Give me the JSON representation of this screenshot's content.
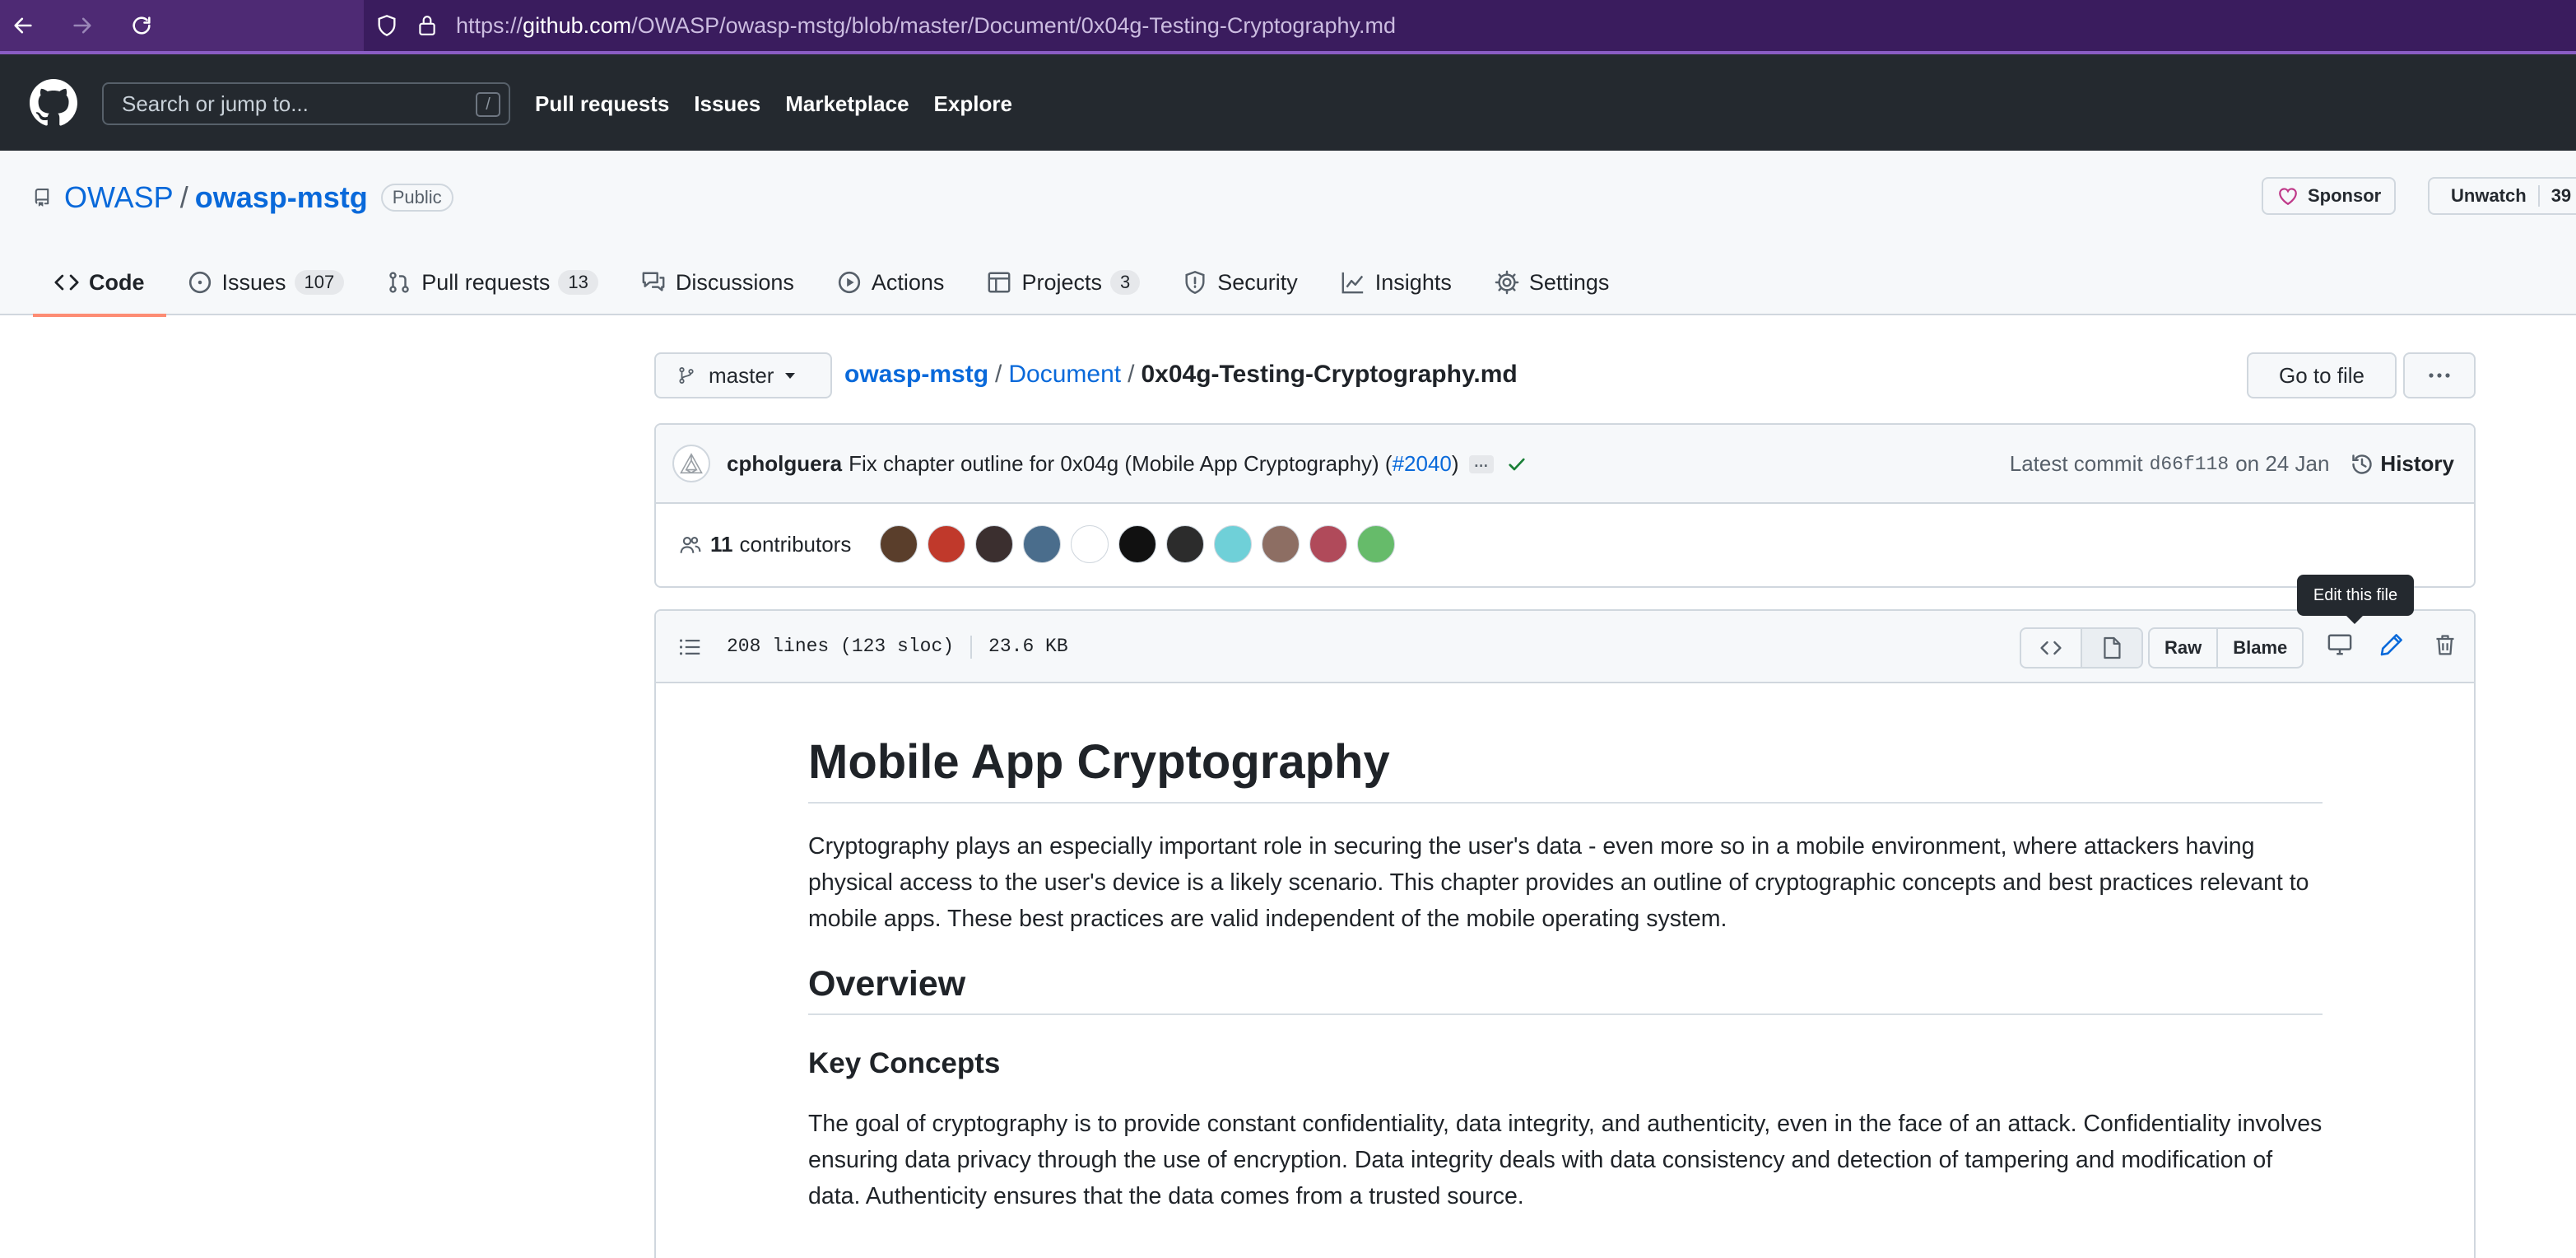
{
  "browser": {
    "url_prefix": "https://",
    "url_host": "github.com",
    "url_path": "/OWASP/owasp-mstg/blob/master/Document/0x04g-Testing-Cryptography.md"
  },
  "header": {
    "search_placeholder": "Search or jump to...",
    "search_shortcut": "/",
    "nav": [
      "Pull requests",
      "Issues",
      "Marketplace",
      "Explore"
    ]
  },
  "repo": {
    "owner": "OWASP",
    "separator": "/",
    "name": "owasp-mstg",
    "visibility": "Public",
    "sponsor_label": "Sponsor",
    "unwatch_label": "Unwatch",
    "unwatch_count": "39"
  },
  "tabs": [
    {
      "label": "Code",
      "icon": "code-icon",
      "active": true
    },
    {
      "label": "Issues",
      "icon": "issue-icon",
      "count": "107"
    },
    {
      "label": "Pull requests",
      "icon": "pull-request-icon",
      "count": "13"
    },
    {
      "label": "Discussions",
      "icon": "discussions-icon"
    },
    {
      "label": "Actions",
      "icon": "play-icon"
    },
    {
      "label": "Projects",
      "icon": "table-icon",
      "count": "3"
    },
    {
      "label": "Security",
      "icon": "shield-icon"
    },
    {
      "label": "Insights",
      "icon": "graph-icon"
    },
    {
      "label": "Settings",
      "icon": "gear-icon"
    }
  ],
  "file_nav": {
    "branch": "master",
    "crumbs": [
      "owasp-mstg",
      "Document"
    ],
    "sep": "/",
    "file": "0x04g-Testing-Cryptography.md",
    "goto_label": "Go to file",
    "more_label": "···"
  },
  "commit": {
    "author": "cpholguera",
    "message": "Fix chapter outline for 0x04g (Mobile App Cryptography) (",
    "pr": "#2040",
    "message_end": ")",
    "ellipsis": "…",
    "latest_label": "Latest commit",
    "sha": "d66f118",
    "date": "on 24 Jan",
    "history_label": "History",
    "contributors_count": "11",
    "contributors_label": "contributors",
    "avatar_colors": [
      "#5a3e2b",
      "#c0392b",
      "#3b2f2f",
      "#4a6d8c",
      "#ffffff",
      "#111111",
      "#2c2c2c",
      "#6fd0d8",
      "#8d6e63",
      "#b04a5a",
      "#66bb6a"
    ]
  },
  "file": {
    "lines": "208 lines (123 sloc)",
    "size": "23.6 KB",
    "raw_label": "Raw",
    "blame_label": "Blame",
    "tooltip": "Edit this file"
  },
  "markdown": {
    "h1": "Mobile App Cryptography",
    "p1": "Cryptography plays an especially important role in securing the user's data - even more so in a mobile environment, where attackers having physical access to the user's device is a likely scenario. This chapter provides an outline of cryptographic concepts and best practices relevant to mobile apps. These best practices are valid independent of the mobile operating system.",
    "h2": "Overview",
    "h3": "Key Concepts",
    "p2": "The goal of cryptography is to provide constant confidentiality, data integrity, and authenticity, even in the face of an attack. Confidentiality involves ensuring data privacy through the use of encryption. Data integrity deals with data consistency and detection of tampering and modification of data. Authenticity ensures that the data comes from a trusted source."
  }
}
